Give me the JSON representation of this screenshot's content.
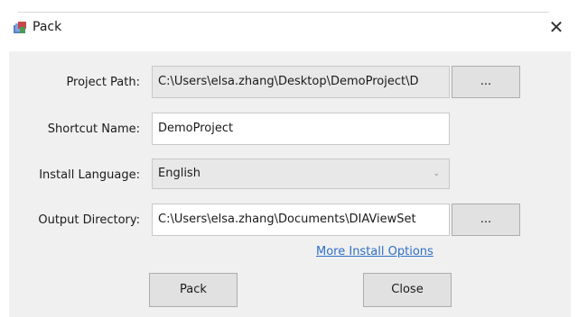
{
  "window": {
    "title": "Pack",
    "close_glyph": "✕",
    "icon": "pack-app-icon"
  },
  "form": {
    "project_path": {
      "label": "Project Path:",
      "value": "C:\\Users\\elsa.zhang\\Desktop\\DemoProject\\D",
      "browse_label": "..."
    },
    "shortcut_name": {
      "label": "Shortcut Name:",
      "value": "DemoProject"
    },
    "install_language": {
      "label": "Install Language:",
      "selected": "English",
      "arrow_glyph": "⌄"
    },
    "output_directory": {
      "label": "Output Directory:",
      "value": "C:\\Users\\elsa.zhang\\Documents\\DIAViewSet",
      "browse_label": "..."
    },
    "more_options_link": "More Install Options"
  },
  "buttons": {
    "pack": "Pack",
    "close": "Close"
  },
  "colors": {
    "client_bg": "#f0f0f0",
    "link": "#2f6fc6",
    "readonly_bg": "#e8e8e8",
    "button_bg": "#e1e1e1"
  }
}
